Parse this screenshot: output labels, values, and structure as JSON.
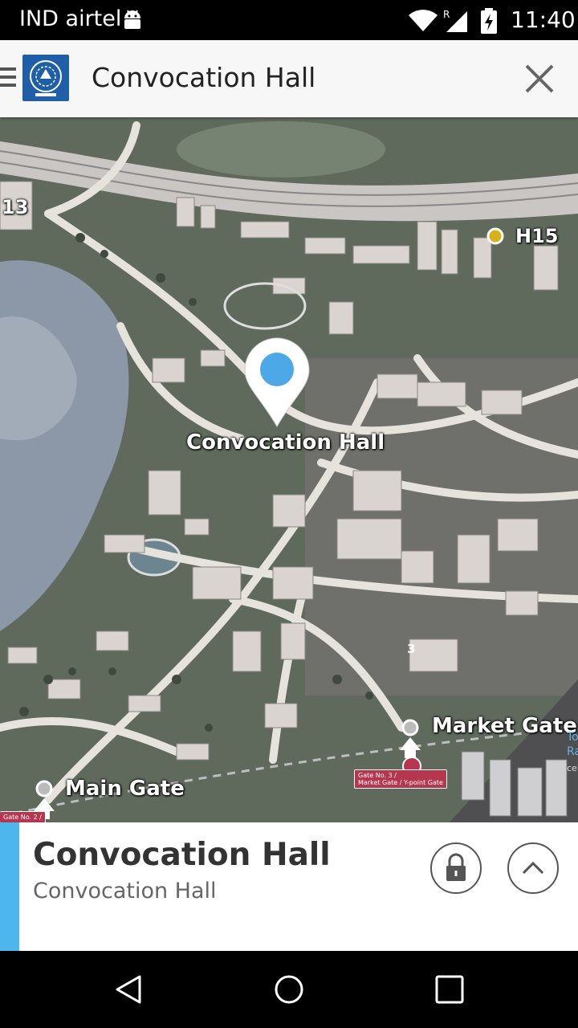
{
  "status_bar": {
    "carrier": "IND airtel",
    "time": "11:40",
    "signal_tag": "R"
  },
  "app_bar": {
    "title": "Convocation Hall",
    "menu_icon": "hamburger-icon",
    "logo": "institute-logo",
    "close_icon": "close-icon"
  },
  "map": {
    "pin_label": "Convocation Hall",
    "labels": {
      "h15": "H15",
      "h13": "13",
      "market_gate": "Market Gate",
      "main_gate": "Main Gate",
      "market_gate_no": "3",
      "gate3_sign_line1": "Gate No. 3 /",
      "gate3_sign_line2": "Market Gate / Y-point Gate",
      "gate2_sign_line1": "Gate No. 2 /",
      "edge_text_1": "To",
      "edge_text_2": "Ra",
      "edge_text_3": "cei"
    }
  },
  "info_panel": {
    "title": "Convocation Hall",
    "subtitle": "Convocation Hall",
    "lock_icon": "lock-icon",
    "expand_icon": "chevron-up-icon",
    "accent_color": "#4db6ec"
  },
  "nav_bar": {
    "back_icon": "back-icon",
    "home_icon": "home-icon",
    "recents_icon": "recents-icon"
  },
  "colors": {
    "pin": "#4da8e8",
    "gate_sign": "#b5364f",
    "map_ground": "#5f6a5c",
    "lake": "#8c98a8"
  }
}
